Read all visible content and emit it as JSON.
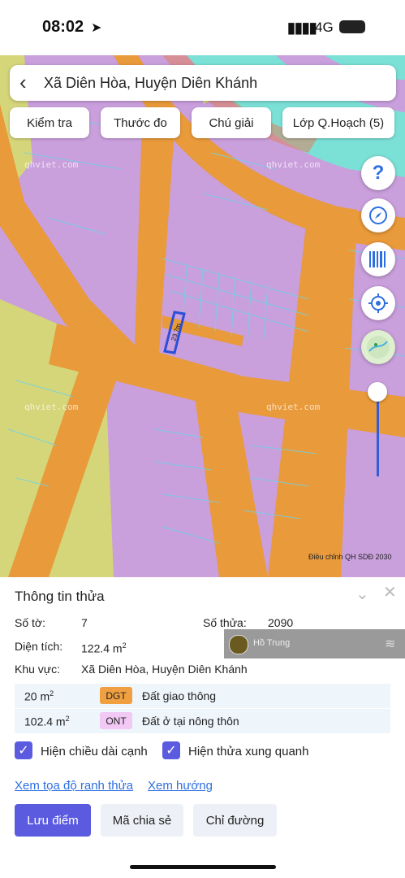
{
  "status_bar": {
    "time": "08:02",
    "network": "4G"
  },
  "header": {
    "title": "Xã Diên Hòa, Huyện Diên Khánh"
  },
  "toolbar": {
    "check": "Kiểm tra",
    "measure": "Thước đo",
    "legend": "Chú giải",
    "layers": "Lớp Q.Hoạch (5)"
  },
  "map": {
    "watermark": "qhviet.com",
    "measure_label": "23.7m",
    "credit": "Điều chỉnh QH SDĐ 2030",
    "colors": {
      "residential": "#c99fdc",
      "traffic": "#e99a3a",
      "agri": "#d5d57a",
      "water": "#7be0d6",
      "parcel_line": "#6fd3e8",
      "selected": "#2b4fd8"
    }
  },
  "sheet": {
    "title": "Thông tin thửa",
    "sheet_no_label": "Số tờ:",
    "sheet_no": "7",
    "parcel_no_label": "Số thửa:",
    "parcel_no": "2090",
    "area_label": "Diện tích:",
    "area": "122.4 m",
    "region_label": "Khu vực:",
    "region": "Xã Diên Hòa, Huyện Diên Khánh",
    "uses": [
      {
        "area": "20 m",
        "code": "DGT",
        "desc": "Đất giao thông",
        "color": "#f0a040"
      },
      {
        "area": "102.4 m",
        "code": "ONT",
        "desc": "Đất ở tại nông thôn",
        "color": "#f2c8f5"
      }
    ],
    "options": {
      "show_edge": "Hiện chiều dài cạnh",
      "show_neighbors": "Hiện thửa xung quanh"
    },
    "links": {
      "coords": "Xem tọa độ ranh thửa",
      "direction": "Xem hướng"
    },
    "actions": {
      "save": "Lưu điểm",
      "share": "Mã chia sẻ",
      "route": "Chỉ đường"
    },
    "user_overlay": "Hồ Trung"
  }
}
